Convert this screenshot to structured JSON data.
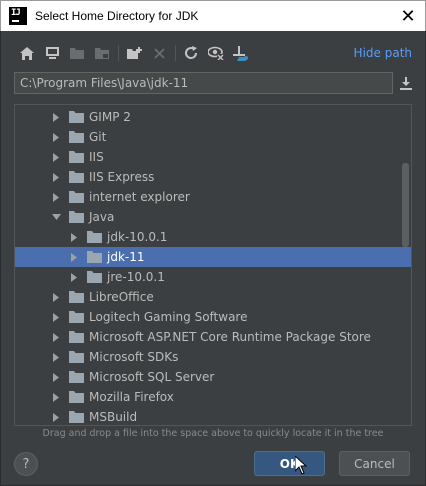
{
  "window": {
    "title": "Select Home Directory for JDK",
    "close_glyph": "✕"
  },
  "toolbar": {
    "buttons": [
      "home-icon",
      "desktop-icon",
      "project-icon",
      "module-icon",
      "new-folder-icon",
      "delete-icon",
      "refresh-icon",
      "show-hidden-icon",
      "attach-icon"
    ],
    "hide_path_label": "Hide path"
  },
  "path": {
    "value": "C:\\Program Files\\Java\\jdk-11"
  },
  "tree": {
    "items": [
      {
        "label": "GIMP 2",
        "level": 0,
        "expanded": false,
        "selected": false
      },
      {
        "label": "Git",
        "level": 0,
        "expanded": false,
        "selected": false
      },
      {
        "label": "IIS",
        "level": 0,
        "expanded": false,
        "selected": false
      },
      {
        "label": "IIS Express",
        "level": 0,
        "expanded": false,
        "selected": false
      },
      {
        "label": "internet explorer",
        "level": 0,
        "expanded": false,
        "selected": false
      },
      {
        "label": "Java",
        "level": 0,
        "expanded": true,
        "selected": false
      },
      {
        "label": "jdk-10.0.1",
        "level": 1,
        "expanded": false,
        "selected": false
      },
      {
        "label": "jdk-11",
        "level": 1,
        "expanded": false,
        "selected": true
      },
      {
        "label": "jre-10.0.1",
        "level": 1,
        "expanded": false,
        "selected": false
      },
      {
        "label": "LibreOffice",
        "level": 0,
        "expanded": false,
        "selected": false
      },
      {
        "label": "Logitech Gaming Software",
        "level": 0,
        "expanded": false,
        "selected": false
      },
      {
        "label": "Microsoft ASP.NET Core Runtime Package Store",
        "level": 0,
        "expanded": false,
        "selected": false
      },
      {
        "label": "Microsoft SDKs",
        "level": 0,
        "expanded": false,
        "selected": false
      },
      {
        "label": "Microsoft SQL Server",
        "level": 0,
        "expanded": false,
        "selected": false
      },
      {
        "label": "Mozilla Firefox",
        "level": 0,
        "expanded": false,
        "selected": false
      },
      {
        "label": "MSBuild",
        "level": 0,
        "expanded": false,
        "selected": false
      }
    ]
  },
  "hint": "Drag and drop a file into the space above to quickly locate it in the tree",
  "buttons": {
    "help": "?",
    "ok": "OK",
    "cancel": "Cancel"
  },
  "colors": {
    "background": "#3c3f41",
    "selection": "#4b6eaf",
    "link": "#589df6",
    "folder": "#9aa7b0"
  }
}
